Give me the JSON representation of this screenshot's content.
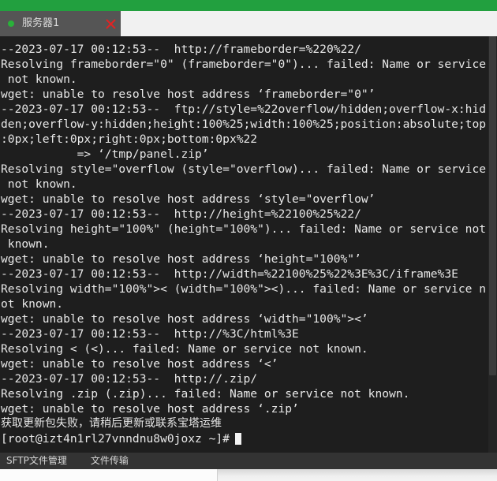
{
  "window": {
    "accent_green": "#22a03f",
    "terminal_bg": "#1e1e1e",
    "terminal_fg": "#e8e8e8"
  },
  "tabs": [
    {
      "label": "服务器1",
      "status": "connected",
      "status_color": "#2ab13a",
      "close_label": "×"
    }
  ],
  "terminal": {
    "lines": [
      "--2023-07-17 00:12:53--  http://frameborder=%220%22/",
      "Resolving frameborder=\"0\" (frameborder=\"0\")... failed: Name or service",
      " not known.",
      "wget: unable to resolve host address ‘frameborder=\"0\"’",
      "--2023-07-17 00:12:53--  ftp://style=%22overflow/hidden;overflow-x:hid",
      "den;overflow-y:hidden;height:100%25;width:100%25;position:absolute;top",
      ":0px;left:0px;right:0px;bottom:0px%22",
      "           => ‘/tmp/panel.zip’",
      "Resolving style=\"overflow (style=\"overflow)... failed: Name or service",
      " not known.",
      "wget: unable to resolve host address ‘style=\"overflow’",
      "--2023-07-17 00:12:53--  http://height=%22100%25%22/",
      "Resolving height=\"100%\" (height=\"100%\")... failed: Name or service not",
      " known.",
      "wget: unable to resolve host address ‘height=\"100%\"’",
      "--2023-07-17 00:12:53--  http://width=%22100%25%22%3E%3C/iframe%3E",
      "Resolving width=\"100%\">< (width=\"100%\"><)... failed: Name or service n",
      "ot known.",
      "wget: unable to resolve host address ‘width=\"100%\"><’",
      "--2023-07-17 00:12:53--  http://%3C/html%3E",
      "Resolving < (<)... failed: Name or service not known.",
      "wget: unable to resolve host address ‘<’",
      "--2023-07-17 00:12:53--  http://.zip/",
      "Resolving .zip (.zip)... failed: Name or service not known.",
      "wget: unable to resolve host address ‘.zip’"
    ],
    "notice": "获取更新包失败，请稍后更新或联系宝塔运维",
    "prompt": "[root@izt4n1rl27vnndnu8w0joxz ~]#",
    "prompt_user": "root",
    "prompt_host": "izt4n1rl27vnndnu8w0joxz",
    "prompt_cwd": "~"
  },
  "statusbar": {
    "sftp_label": "SFTP文件管理",
    "transfer_label": "文件传输"
  }
}
